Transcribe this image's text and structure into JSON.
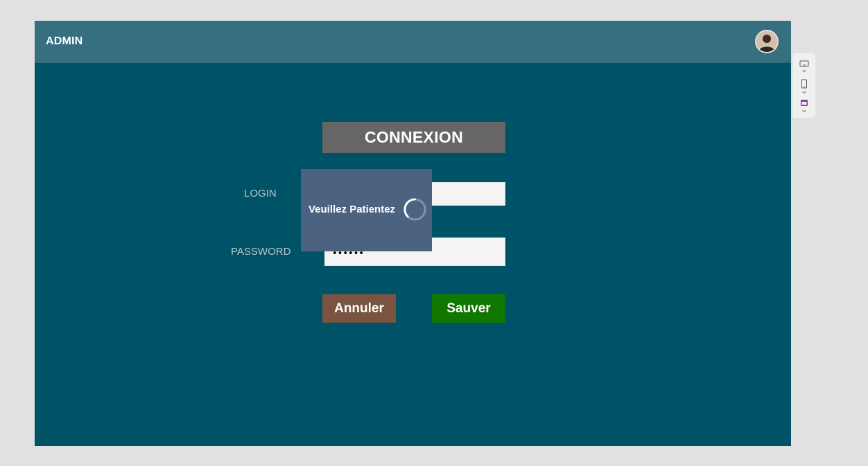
{
  "header": {
    "title": "ADMIN"
  },
  "login_form": {
    "title": "CONNEXION",
    "login_label": "LOGIN",
    "login_value": "",
    "password_label": "PASSWORD",
    "password_value": "••••••",
    "cancel_label": "Annuler",
    "save_label": "Sauver"
  },
  "loading_overlay": {
    "message": "Veuillez Patientez"
  },
  "side_panel": {
    "icons": [
      "monitor-icon",
      "phone-icon",
      "calendar-icon"
    ]
  },
  "colors": {
    "page_background": "#005266",
    "header_background": "#367080",
    "title_background": "#666666",
    "cancel_button": "#7b5441",
    "save_button": "#127700",
    "overlay_background": "#4b6381"
  }
}
